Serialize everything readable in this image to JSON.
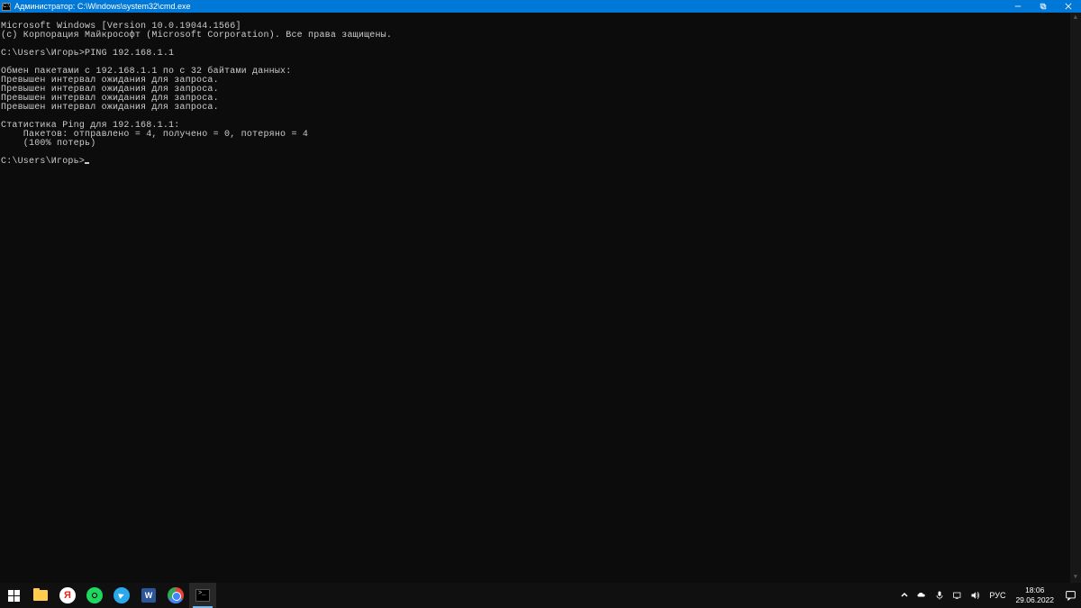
{
  "window": {
    "title": "Администратор: C:\\Windows\\system32\\cmd.exe"
  },
  "terminal": {
    "lines": [
      "Microsoft Windows [Version 10.0.19044.1566]",
      "(c) Корпорация Майкрософт (Microsoft Corporation). Все права защищены.",
      "",
      "C:\\Users\\Игорь>PING 192.168.1.1",
      "",
      "Обмен пакетами с 192.168.1.1 по с 32 байтами данных:",
      "Превышен интервал ожидания для запроса.",
      "Превышен интервал ожидания для запроса.",
      "Превышен интервал ожидания для запроса.",
      "Превышен интервал ожидания для запроса.",
      "",
      "Статистика Ping для 192.168.1.1:",
      "    Пакетов: отправлено = 4, получено = 0, потеряно = 4",
      "    (100% потерь)",
      "",
      "C:\\Users\\Игорь>"
    ]
  },
  "taskbar": {
    "word_label": "W",
    "yandex_label": "Я",
    "language": "РУС",
    "time": "18:06",
    "date": "29.06.2022"
  }
}
